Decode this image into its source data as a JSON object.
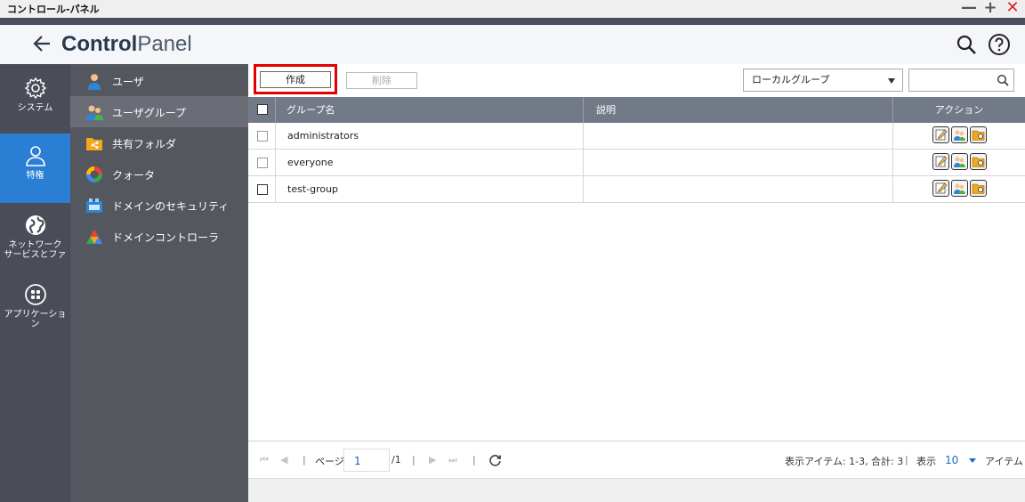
{
  "window": {
    "title": "コントロール-パネル",
    "minimize": "—",
    "maximize": "+",
    "close": "✕"
  },
  "header": {
    "title_bold": "Control",
    "title_light": "Panel"
  },
  "main_nav": [
    {
      "label": "システム",
      "icon": "gear-icon"
    },
    {
      "label": "特権",
      "icon": "user-icon",
      "active": true
    },
    {
      "label": "ネットワーク サービスとファ",
      "icon": "globe-icon"
    },
    {
      "label": "アプリケーション",
      "icon": "apps-icon"
    }
  ],
  "sub_nav": [
    {
      "label": "ユーザ",
      "icon": "user-icon"
    },
    {
      "label": "ユーザグループ",
      "icon": "user-group-icon",
      "active": true
    },
    {
      "label": "共有フォルダ",
      "icon": "shared-folder-icon"
    },
    {
      "label": "クォータ",
      "icon": "quota-icon"
    },
    {
      "label": "ドメインのセキュリティ",
      "icon": "domain-security-icon"
    },
    {
      "label": "ドメインコントローラ",
      "icon": "domain-controller-icon"
    }
  ],
  "toolbar": {
    "create_label": "作成",
    "delete_label": "削除",
    "group_type": "ローカルグループ",
    "search_value": ""
  },
  "table": {
    "columns": [
      "グループ名",
      "説明",
      "アクション"
    ],
    "rows": [
      {
        "name": "administrators",
        "description": ""
      },
      {
        "name": "everyone",
        "description": ""
      },
      {
        "name": "test-group",
        "description": ""
      }
    ]
  },
  "pager": {
    "page_label": "ページ",
    "current_page": "1",
    "total_pages": "/1",
    "items_info": "表示アイテム: 1-3, 合計: 3",
    "show_label": "表示",
    "per_page": "10",
    "items_label": "アイテム"
  },
  "colors": {
    "accent": "#2a7fd4",
    "highlight_box": "#e30000",
    "nav_bg": "#4a4c58",
    "subnav_bg": "#55575f",
    "table_header": "#737a87"
  }
}
